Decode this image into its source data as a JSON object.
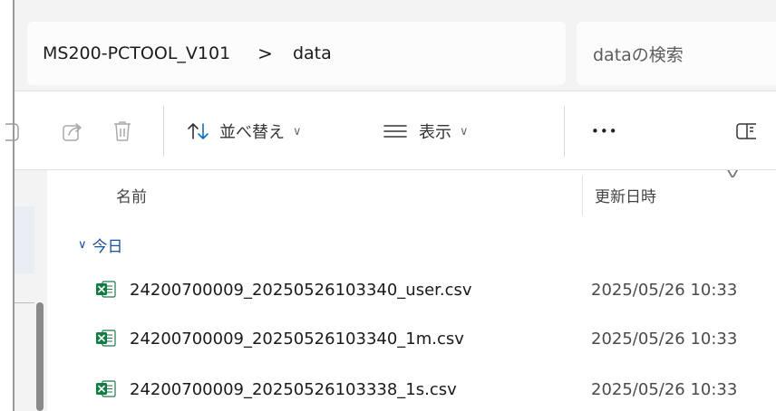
{
  "address_bar": {
    "breadcrumb": [
      "MS200-PCTOOL_V101",
      "data"
    ],
    "separator": ">",
    "search_placeholder": "dataの検索"
  },
  "toolbar": {
    "sort_label": "並べ替え",
    "view_label": "表示",
    "more_label": "•••",
    "icons": [
      "share-icon",
      "delete-icon",
      "sort-icon",
      "view-icon",
      "details-pane-icon"
    ]
  },
  "columns": {
    "name": "名前",
    "modified": "更新日時"
  },
  "group": {
    "label": "今日"
  },
  "files": [
    {
      "name": "24200700009_20250526103340_user.csv",
      "modified": "2025/05/26 10:33",
      "icon": "excel-csv-icon"
    },
    {
      "name": "24200700009_20250526103340_1m.csv",
      "modified": "2025/05/26 10:33",
      "icon": "excel-csv-icon"
    },
    {
      "name": "24200700009_20250526103338_1s.csv",
      "modified": "2025/05/26 10:33",
      "icon": "excel-csv-icon"
    }
  ],
  "colors": {
    "accent": "#0f6cbd",
    "excel_green": "#107c41",
    "group_text": "#1a4fa3"
  }
}
